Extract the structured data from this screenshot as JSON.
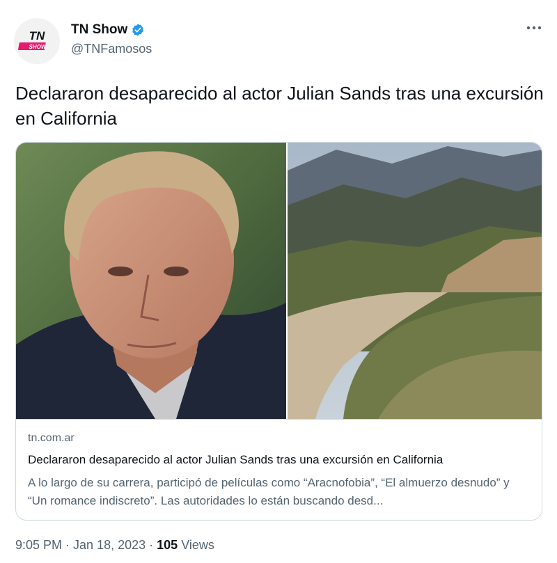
{
  "author": {
    "name": "TN Show",
    "handle": "@TNFamosos",
    "avatar_text_top": "TN",
    "avatar_text_bottom": "SHOW",
    "verified_icon": "verified-badge-icon"
  },
  "menu": {
    "icon": "more-horizontal-icon"
  },
  "tweet": {
    "text": "Declararon desaparecido al actor Julian Sands tras una excursión en California"
  },
  "card": {
    "domain": "tn.com.ar",
    "title": "Declararon desaparecido al actor Julian Sands tras una excursión en California",
    "description": "A lo largo de su carrera, participó de películas como “Aracnofobia”, “El almuerzo desnudo” y “Un romance indiscreto”. Las autoridades lo están buscando desd..."
  },
  "footer": {
    "time": "9:05 PM",
    "separator": " · ",
    "date": "Jan 18, 2023",
    "views_count": "105",
    "views_label": "Views"
  },
  "colors": {
    "text": "#0f1419",
    "secondary": "#536471",
    "border": "#cfd9de",
    "verified": "#1d9bf0",
    "brand_pink": "#e6196e"
  }
}
